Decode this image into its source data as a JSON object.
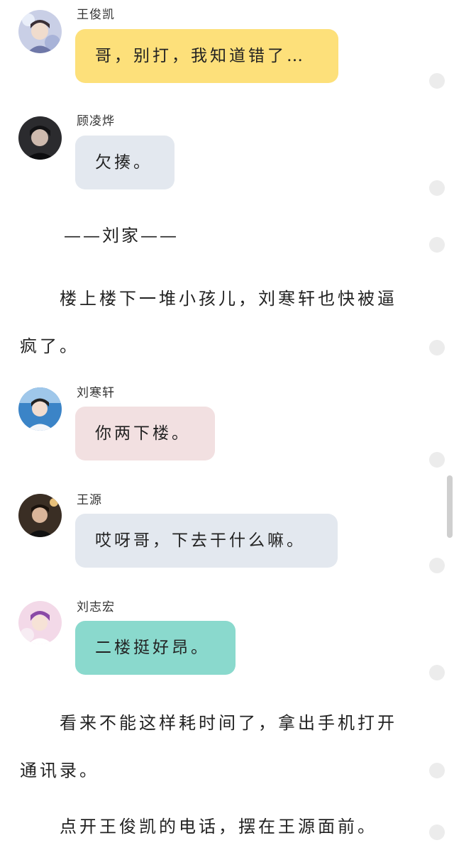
{
  "messages": [
    {
      "sender": "王俊凯",
      "text": "哥，别打，我知道错了…",
      "bubble_color": "#fde07a"
    },
    {
      "sender": "顾凌烨",
      "text": "欠揍。",
      "bubble_color": "#e3e8ef"
    },
    {
      "sender": "刘寒轩",
      "text": "你两下楼。",
      "bubble_color": "#f2e0e1"
    },
    {
      "sender": "王源",
      "text": "哎呀哥，下去干什么嘛。",
      "bubble_color": "#e3e8ef"
    },
    {
      "sender": "刘志宏",
      "text": "二楼挺好昂。",
      "bubble_color": "#8ad9cd"
    }
  ],
  "divider": "——刘家——",
  "narrative": [
    "楼上楼下一堆小孩儿，刘寒轩也快被逼疯了。",
    "看来不能这样耗时间了，拿出手机打开通讯录。",
    "点开王俊凯的电话，摆在王源面前。"
  ]
}
